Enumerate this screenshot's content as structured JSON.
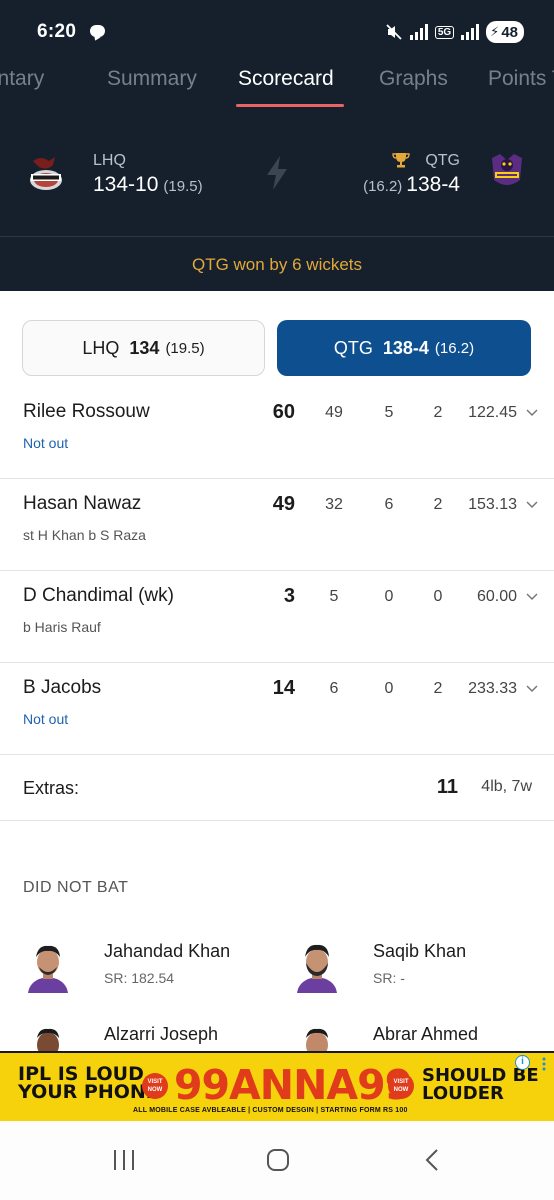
{
  "status_bar": {
    "time": "6:20",
    "network": "5G",
    "battery": "48"
  },
  "tabs": [
    {
      "label": "Commentary"
    },
    {
      "label": "Summary"
    },
    {
      "label": "Scorecard",
      "active": true
    },
    {
      "label": "Graphs"
    },
    {
      "label": "Points Table"
    }
  ],
  "match": {
    "team_left": {
      "short": "LHQ",
      "score": "134-10",
      "overs": "(19.5)"
    },
    "team_right": {
      "short": "QTG",
      "score": "138-4",
      "overs": "(16.2)"
    },
    "result": "QTG won by 6 wickets"
  },
  "innings_toggle": {
    "left": {
      "team": "LHQ",
      "score": "134",
      "overs": "(19.5)"
    },
    "right": {
      "team": "QTG",
      "score": "138-4",
      "overs": "(16.2)",
      "selected": true
    }
  },
  "batters": [
    {
      "name": "Rilee Rossouw",
      "dismissal": "Not out",
      "not_out": true,
      "runs": "60",
      "balls": "49",
      "fours": "5",
      "sixes": "2",
      "sr": "122.45"
    },
    {
      "name": "Hasan Nawaz",
      "dismissal": "st H Khan b S Raza",
      "not_out": false,
      "runs": "49",
      "balls": "32",
      "fours": "6",
      "sixes": "2",
      "sr": "153.13"
    },
    {
      "name": "D Chandimal (wk)",
      "dismissal": "b Haris Rauf",
      "not_out": false,
      "runs": "3",
      "balls": "5",
      "fours": "0",
      "sixes": "0",
      "sr": "60.00"
    },
    {
      "name": "B Jacobs",
      "dismissal": "Not out",
      "not_out": true,
      "runs": "14",
      "balls": "6",
      "fours": "0",
      "sixes": "2",
      "sr": "233.33"
    }
  ],
  "extras": {
    "label": "Extras:",
    "value": "11",
    "detail": "4lb, 7w"
  },
  "did_not_bat": {
    "title": "DID NOT BAT",
    "players": [
      {
        "name": "Jahandad Khan",
        "sr": "SR: 182.54"
      },
      {
        "name": "Saqib Khan",
        "sr": "SR: -"
      },
      {
        "name": "Alzarri Joseph",
        "sr": ""
      },
      {
        "name": "Abrar Ahmed",
        "sr": ""
      }
    ]
  },
  "ad": {
    "left_text_1": "IPL IS LOUD.",
    "left_text_2": "YOUR PHONE",
    "brand": "99ANNA99",
    "right_text_1": "SHOULD BE",
    "right_text_2": "LOUDER",
    "visit_label": "VISIT NOW",
    "tagline": "ALL MOBILE CASE AVBLEABLE | CUSTOM DESGIN | STARTING FORM RS 100",
    "info": "i"
  },
  "colors": {
    "header_bg": "#15202c",
    "accent": "#e86565",
    "selected_toggle": "#0d4f8f",
    "result_text": "#e3a83a",
    "not_out": "#1e63b0"
  }
}
